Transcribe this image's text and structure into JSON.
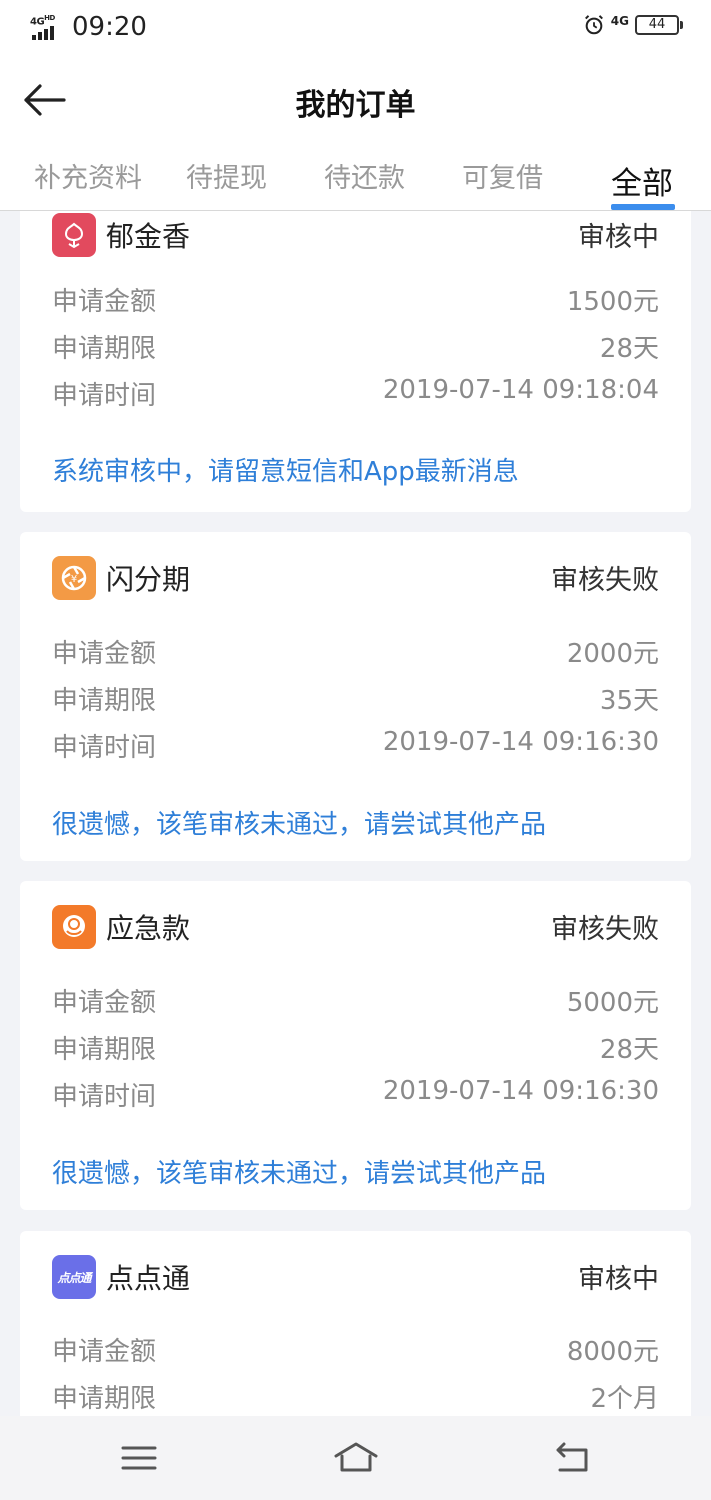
{
  "status_bar": {
    "network": "4G",
    "network_sup": "HD",
    "time": "09:20",
    "cell": "4G",
    "battery": "44"
  },
  "header": {
    "title": "我的订单"
  },
  "tabs": [
    {
      "label": "补充资料"
    },
    {
      "label": "待提现"
    },
    {
      "label": "待还款"
    },
    {
      "label": "可复借"
    },
    {
      "label": "全部"
    }
  ],
  "orders": [
    {
      "name": "郁金香",
      "status": "审核中",
      "logo_color": "#e24a5e",
      "logo_icon": "tulip-logo-icon",
      "rows": [
        {
          "label": "申请金额",
          "value": "1500元"
        },
        {
          "label": "申请期限",
          "value": "28天"
        },
        {
          "label": "申请时间",
          "value": "2019-07-14 09:18:04"
        }
      ],
      "note": "系统审核中，请留意短信和App最新消息"
    },
    {
      "name": "闪分期",
      "status": "审核失败",
      "logo_color": "#f39a45",
      "logo_icon": "yuan-logo-icon",
      "rows": [
        {
          "label": "申请金额",
          "value": "2000元"
        },
        {
          "label": "申请期限",
          "value": "35天"
        },
        {
          "label": "申请时间",
          "value": "2019-07-14 09:16:30"
        }
      ],
      "note": "很遗憾，该笔审核未通过，请尝试其他产品"
    },
    {
      "name": "应急款",
      "status": "审核失败",
      "logo_color": "#f37a2a",
      "logo_icon": "coin-logo-icon",
      "rows": [
        {
          "label": "申请金额",
          "value": "5000元"
        },
        {
          "label": "申请期限",
          "value": "28天"
        },
        {
          "label": "申请时间",
          "value": "2019-07-14 09:16:30"
        }
      ],
      "note": "很遗憾，该笔审核未通过，请尝试其他产品"
    },
    {
      "name": "点点通",
      "status": "审核中",
      "logo_color": "#6a6fe8",
      "logo_icon": "diandiantong-logo-icon",
      "logo_text": "点点通",
      "rows": [
        {
          "label": "申请金额",
          "value": "8000元"
        },
        {
          "label": "申请期限",
          "value": "2个月"
        }
      ]
    }
  ],
  "navbar": {
    "icons": [
      "menu-icon",
      "home-icon",
      "back-nav-icon"
    ]
  }
}
